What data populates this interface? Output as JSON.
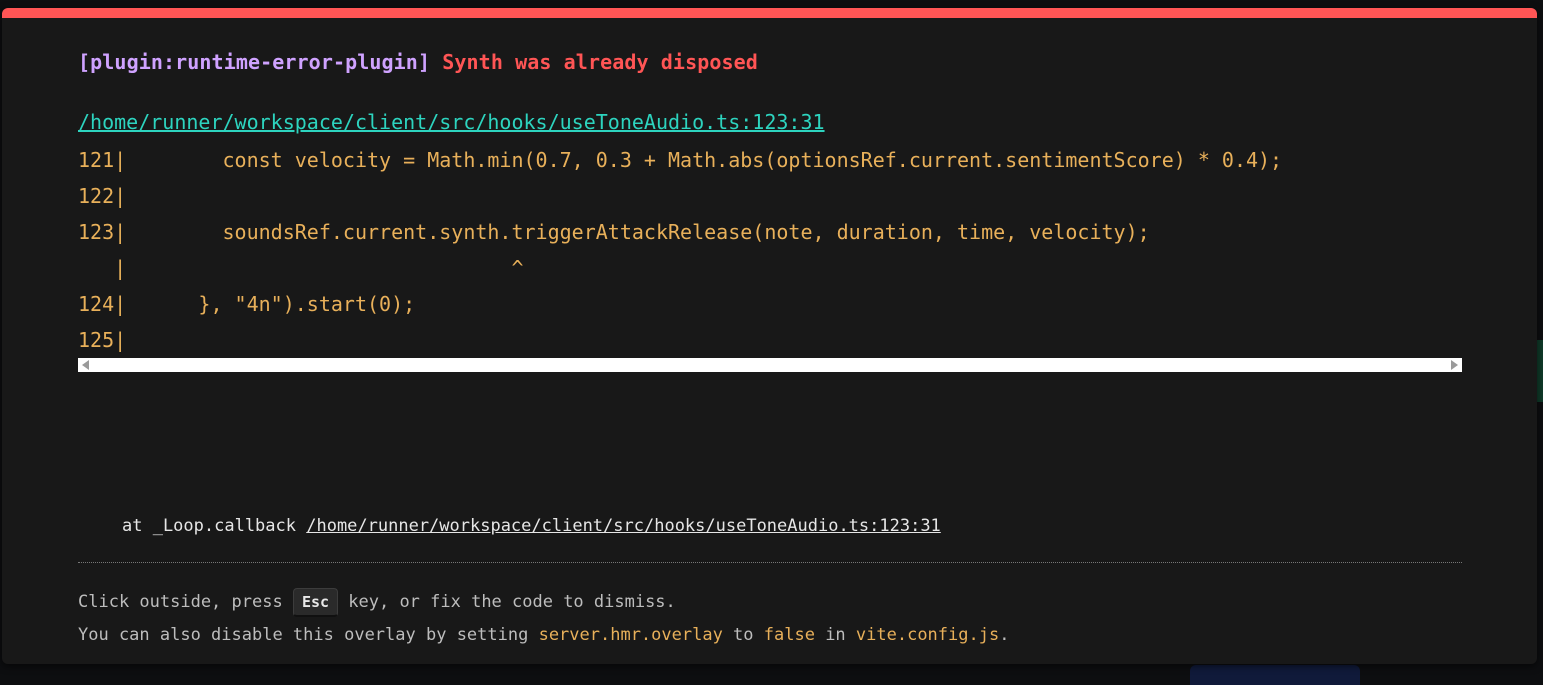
{
  "error": {
    "plugin": "[plugin:runtime-error-plugin]",
    "message": "Synth was already disposed"
  },
  "file_link": "/home/runner/workspace/client/src/hooks/useToneAudio.ts:123:31",
  "code_frame": [
    "121|        const velocity = Math.min(0.7, 0.3 + Math.abs(optionsRef.current.sentimentScore) * 0.4);",
    "122|",
    "123|        soundsRef.current.synth.triggerAttackRelease(note, duration, time, velocity);",
    "   |                                ^",
    "124|      }, \"4n\").start(0);",
    "125|"
  ],
  "stack": {
    "prefix": "at _Loop.callback ",
    "location": "/home/runner/workspace/client/src/hooks/useToneAudio.ts:123:31"
  },
  "tip": {
    "line1_before": "Click outside, press ",
    "key": "Esc",
    "line1_after": " key, or fix the code to dismiss.",
    "line2_before": "You can also disable this overlay by setting ",
    "setting": "server.hmr.overlay",
    "line2_mid": " to ",
    "value": "false",
    "line2_mid2": " in ",
    "config_file": "vite.config.js",
    "line2_after": "."
  },
  "colors": {
    "accent_border": "#ff5555",
    "plugin": "#cfa2ff",
    "error": "#ff5555",
    "link": "#2dd4bf",
    "code": "#e8b05a"
  }
}
